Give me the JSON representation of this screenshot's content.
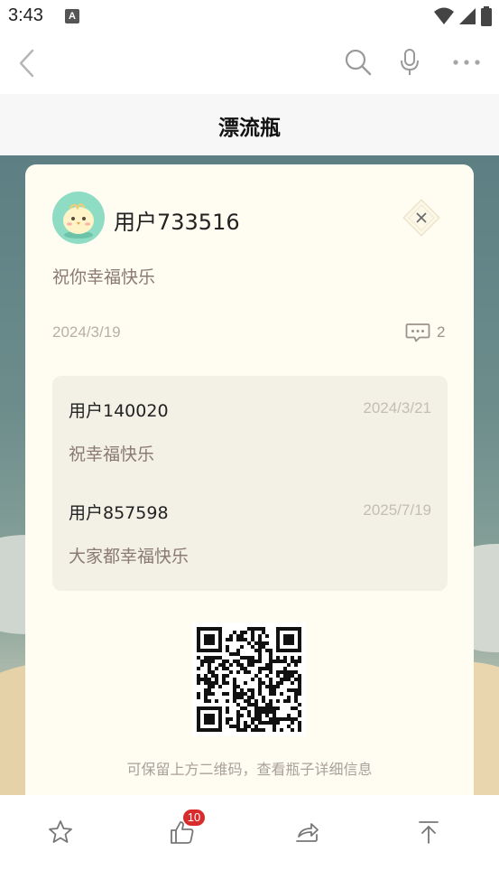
{
  "status_bar": {
    "time": "3:43",
    "notification_letter": "A"
  },
  "page": {
    "title": "漂流瓶"
  },
  "bottle": {
    "author": "用户733516",
    "message": "祝你幸福快乐",
    "date": "2024/3/19",
    "comment_count": "2",
    "replies": [
      {
        "user": "用户140020",
        "date": "2024/3/21",
        "text": "祝幸福快乐"
      },
      {
        "user": "用户857598",
        "date": "2025/7/19",
        "text": "大家都幸福快乐"
      }
    ],
    "qr_hint": "可保留上方二维码，查看瓶子详细信息"
  },
  "bottom_bar": {
    "like_count": "10"
  },
  "icons": {
    "back": "back-arrow-icon",
    "search": "search-icon",
    "mic": "microphone-icon",
    "more": "more-dots-icon",
    "close": "close-icon",
    "comment": "comment-icon",
    "star": "star-icon",
    "like": "thumbs-up-icon",
    "share": "share-icon",
    "top": "scroll-to-top-icon"
  },
  "colors": {
    "card_bg": "#fffdf2",
    "reply_bg": "#f3f1e6",
    "badge_red": "#d92b2b",
    "avatar_bg": "#8fdcc4"
  }
}
